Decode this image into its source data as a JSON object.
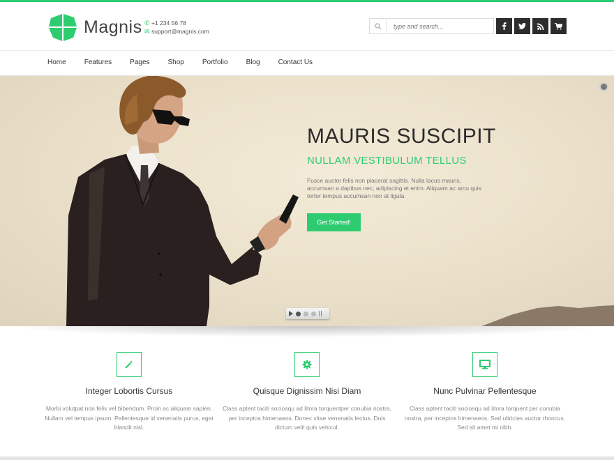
{
  "brand": {
    "name": "Magnis",
    "accent": "#2ecc71",
    "phone": "+1 234 56 78",
    "email": "support@magnis.com",
    "phone_icon": "phone-icon",
    "email_icon": "envelope-icon"
  },
  "search": {
    "placeholder": "type and search...",
    "icon": "search-icon"
  },
  "social": [
    {
      "name": "facebook-icon",
      "glyph": "f"
    },
    {
      "name": "twitter-icon",
      "glyph": "t"
    },
    {
      "name": "rss-icon",
      "glyph": "r"
    },
    {
      "name": "cart-icon",
      "glyph": "c"
    }
  ],
  "nav": {
    "items": [
      "Home",
      "Features",
      "Pages",
      "Shop",
      "Portfolio",
      "Blog",
      "Contact Us"
    ]
  },
  "hero": {
    "title": "MAURIS SUSCIPIT",
    "subtitle": "NULLAM VESTIBULUM TELLUS",
    "text": "Fusce auctor felis non placerat sagittis. Nulla lacus mauris, accumsan a dapibus nec, adipiscing et enim. Aliquam ac arcu quis tortor tempus accumsan non at ligula.",
    "button": "Get Started!"
  },
  "features": [
    {
      "icon": "magic-wand-icon",
      "title": "Integer Lobortis Cursus",
      "text": "Morbi volutpat non felis vel bibendum. Proin ac aliquam sapien. Nullam vel tempus ipsum. Pellentesque id venenatis purus, eget blandit nisl."
    },
    {
      "icon": "gear-icon",
      "title": "Quisque Dignissim Nisi Diam",
      "text": "Class aptent taciti sociosqu ad litora torquentper conubia nostra, per inceptos himenaeos. Donec vitae venenatis lectus. Duis dictum velit quis vehicul."
    },
    {
      "icon": "monitor-icon",
      "title": "Nunc Pulvinar Pellentesque",
      "text": "Class aptent taciti sociosqu ad litora torquent per conubia nostra, per inceptos himenaeos. Sed ultricies auctor rhoncus. Sed sit amet mi nibh."
    }
  ]
}
